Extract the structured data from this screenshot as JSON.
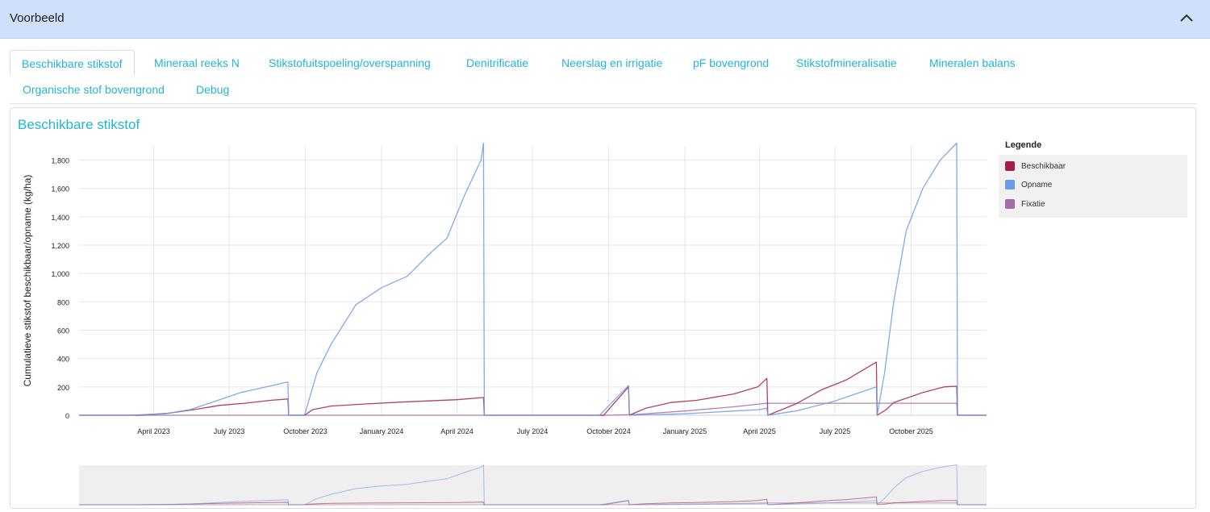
{
  "header": {
    "title": "Voorbeeld"
  },
  "tabs": [
    {
      "label": "Beschikbare stikstof",
      "active": true
    },
    {
      "label": "Mineraal reeks N"
    },
    {
      "label": "Stikstofuitspoeling/overspanning"
    },
    {
      "label": "Denitrificatie"
    },
    {
      "label": "Neerslag en irrigatie"
    },
    {
      "label": "pF bovengrond"
    },
    {
      "label": "Stikstofmineralisatie"
    },
    {
      "label": "Mineralen balans"
    },
    {
      "label": "Organische stof bovengrond"
    },
    {
      "label": "Debug"
    }
  ],
  "panel": {
    "title": "Beschikbare stikstof"
  },
  "legend": {
    "heading": "Legende",
    "items": [
      {
        "label": "Beschikbaar",
        "color": "#a61d4a"
      },
      {
        "label": "Opname",
        "color": "#6b9ae8"
      },
      {
        "label": "Fixatie",
        "color": "#a76aa8"
      }
    ]
  },
  "chart_data": {
    "type": "line",
    "title": "",
    "ylabel": "Cumulatieve stikstof beschikbaar/opname (kg/ha)",
    "xlabel": "",
    "ylim": [
      0,
      1900
    ],
    "yticks": [
      0,
      200,
      400,
      600,
      800,
      1000,
      1200,
      1400,
      1600,
      1800
    ],
    "ytick_labels": [
      "0",
      "200",
      "400",
      "600",
      "800",
      "1,000",
      "1,200",
      "1,400",
      "1,600",
      "1,800"
    ],
    "xlim": [
      "2023-01-01",
      "2025-12-31"
    ],
    "xticks": [
      "2023-04-01",
      "2023-07-01",
      "2023-10-01",
      "2024-01-01",
      "2024-04-01",
      "2024-07-01",
      "2024-10-01",
      "2025-01-01",
      "2025-04-01",
      "2025-07-01",
      "2025-10-01"
    ],
    "xtick_labels": [
      "April 2023",
      "July 2023",
      "October 2023",
      "January 2024",
      "April 2024",
      "July 2024",
      "October 2024",
      "January 2025",
      "April 2025",
      "July 2025",
      "October 2025"
    ],
    "grid": true,
    "legend_position": "right",
    "navigator": true,
    "series": [
      {
        "name": "Opname",
        "color": "#6b9ae8",
        "points": [
          [
            "2023-01-01",
            0
          ],
          [
            "2023-03-01",
            0
          ],
          [
            "2023-04-15",
            10
          ],
          [
            "2023-05-15",
            40
          ],
          [
            "2023-06-15",
            100
          ],
          [
            "2023-07-15",
            160
          ],
          [
            "2023-08-15",
            200
          ],
          [
            "2023-09-10",
            235
          ],
          [
            "2023-09-11",
            0
          ],
          [
            "2023-09-30",
            0
          ],
          [
            "2023-10-15",
            300
          ],
          [
            "2023-11-01",
            500
          ],
          [
            "2023-12-01",
            780
          ],
          [
            "2024-01-01",
            900
          ],
          [
            "2024-02-01",
            980
          ],
          [
            "2024-03-01",
            1150
          ],
          [
            "2024-03-20",
            1250
          ],
          [
            "2024-04-10",
            1550
          ],
          [
            "2024-04-30",
            1800
          ],
          [
            "2024-05-03",
            1920
          ],
          [
            "2024-05-04",
            0
          ],
          [
            "2024-09-20",
            0
          ],
          [
            "2024-10-10",
            120
          ],
          [
            "2024-10-25",
            210
          ],
          [
            "2024-10-26",
            0
          ],
          [
            "2025-01-01",
            10
          ],
          [
            "2025-04-01",
            40
          ],
          [
            "2025-04-10",
            50
          ],
          [
            "2025-04-11",
            0
          ],
          [
            "2025-05-15",
            30
          ],
          [
            "2025-07-01",
            100
          ],
          [
            "2025-08-20",
            200
          ],
          [
            "2025-08-21",
            0
          ],
          [
            "2025-08-30",
            300
          ],
          [
            "2025-09-10",
            800
          ],
          [
            "2025-09-25",
            1300
          ],
          [
            "2025-10-15",
            1600
          ],
          [
            "2025-11-05",
            1800
          ],
          [
            "2025-11-25",
            1920
          ],
          [
            "2025-11-26",
            0
          ],
          [
            "2025-12-31",
            0
          ]
        ]
      },
      {
        "name": "Beschikbaar",
        "color": "#a61d4a",
        "points": [
          [
            "2023-01-01",
            0
          ],
          [
            "2023-03-15",
            0
          ],
          [
            "2023-04-20",
            15
          ],
          [
            "2023-05-20",
            40
          ],
          [
            "2023-06-20",
            70
          ],
          [
            "2023-07-20",
            85
          ],
          [
            "2023-08-20",
            105
          ],
          [
            "2023-09-10",
            115
          ],
          [
            "2023-09-11",
            0
          ],
          [
            "2023-09-30",
            0
          ],
          [
            "2023-10-10",
            40
          ],
          [
            "2023-11-01",
            65
          ],
          [
            "2023-12-15",
            80
          ],
          [
            "2024-02-01",
            95
          ],
          [
            "2024-04-01",
            110
          ],
          [
            "2024-05-03",
            125
          ],
          [
            "2024-05-04",
            0
          ],
          [
            "2024-09-25",
            0
          ],
          [
            "2024-10-25",
            200
          ],
          [
            "2024-10-26",
            0
          ],
          [
            "2024-11-15",
            50
          ],
          [
            "2024-12-15",
            90
          ],
          [
            "2025-01-15",
            105
          ],
          [
            "2025-03-01",
            150
          ],
          [
            "2025-03-30",
            200
          ],
          [
            "2025-04-10",
            260
          ],
          [
            "2025-04-11",
            0
          ],
          [
            "2025-05-15",
            80
          ],
          [
            "2025-06-15",
            180
          ],
          [
            "2025-07-15",
            250
          ],
          [
            "2025-08-20",
            375
          ],
          [
            "2025-08-21",
            0
          ],
          [
            "2025-09-01",
            40
          ],
          [
            "2025-09-10",
            90
          ],
          [
            "2025-10-15",
            160
          ],
          [
            "2025-11-10",
            200
          ],
          [
            "2025-11-25",
            205
          ],
          [
            "2025-11-26",
            0
          ],
          [
            "2025-12-31",
            0
          ]
        ]
      },
      {
        "name": "Fixatie",
        "color": "#a76aa8",
        "points": [
          [
            "2023-01-01",
            0
          ],
          [
            "2024-10-01",
            0
          ],
          [
            "2024-11-01",
            5
          ],
          [
            "2025-01-01",
            30
          ],
          [
            "2025-03-01",
            60
          ],
          [
            "2025-04-10",
            85
          ],
          [
            "2025-08-20",
            85
          ],
          [
            "2025-11-25",
            85
          ],
          [
            "2025-11-26",
            0
          ],
          [
            "2025-12-31",
            0
          ]
        ]
      }
    ]
  },
  "colors": {
    "accent": "#23b5d3",
    "header_bg": "#cfe0fb"
  }
}
